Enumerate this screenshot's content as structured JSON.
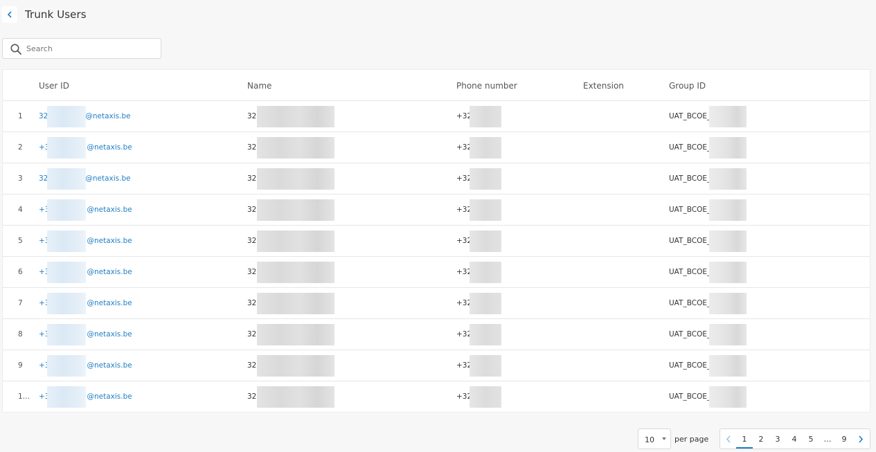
{
  "header": {
    "title": "Trunk Users"
  },
  "search": {
    "placeholder": "Search",
    "value": ""
  },
  "table": {
    "columns": {
      "user_id": "User ID",
      "name": "Name",
      "phone": "Phone number",
      "extension": "Extension",
      "group_id": "Group ID"
    },
    "rows": [
      {
        "index": "1",
        "user_prefix": "32",
        "user_suffix": "@netaxis.be",
        "name_prefix": "32",
        "phone_prefix": "+32",
        "extension": "",
        "group_prefix": "UAT_BCOE_"
      },
      {
        "index": "2",
        "user_prefix": "+3",
        "user_suffix": "@netaxis.be",
        "name_prefix": "32",
        "phone_prefix": "+32",
        "extension": "",
        "group_prefix": "UAT_BCOE_"
      },
      {
        "index": "3",
        "user_prefix": "32",
        "user_suffix": "@netaxis.be",
        "name_prefix": "32",
        "phone_prefix": "+32",
        "extension": "",
        "group_prefix": "UAT_BCOE_"
      },
      {
        "index": "4",
        "user_prefix": "+3",
        "user_suffix": "@netaxis.be",
        "name_prefix": "32",
        "phone_prefix": "+32",
        "extension": "",
        "group_prefix": "UAT_BCOE_"
      },
      {
        "index": "5",
        "user_prefix": "+3",
        "user_suffix": "@netaxis.be",
        "name_prefix": "32",
        "phone_prefix": "+32",
        "extension": "",
        "group_prefix": "UAT_BCOE_"
      },
      {
        "index": "6",
        "user_prefix": "+3",
        "user_suffix": "@netaxis.be",
        "name_prefix": "32",
        "phone_prefix": "+32",
        "extension": "",
        "group_prefix": "UAT_BCOE_"
      },
      {
        "index": "7",
        "user_prefix": "+3",
        "user_suffix": "@netaxis.be",
        "name_prefix": "32",
        "phone_prefix": "+32",
        "extension": "",
        "group_prefix": "UAT_BCOE_"
      },
      {
        "index": "8",
        "user_prefix": "+3",
        "user_suffix": "@netaxis.be",
        "name_prefix": "32",
        "phone_prefix": "+32",
        "extension": "",
        "group_prefix": "UAT_BCOE_"
      },
      {
        "index": "9",
        "user_prefix": "+3",
        "user_suffix": "@netaxis.be",
        "name_prefix": "32",
        "phone_prefix": "+32",
        "extension": "",
        "group_prefix": "UAT_BCOE_"
      },
      {
        "index": "1…",
        "user_prefix": "+3",
        "user_suffix": "@netaxis.be",
        "name_prefix": "32",
        "phone_prefix": "+32",
        "extension": "",
        "group_prefix": "UAT_BCOE_"
      }
    ]
  },
  "pagination": {
    "per_page_value": "10",
    "per_page_label": "per page",
    "pages": [
      "1",
      "2",
      "3",
      "4",
      "5",
      "…",
      "9"
    ],
    "current_page": "1",
    "prev_icon": "chevron-left-icon",
    "next_icon": "chevron-right-icon"
  },
  "colors": {
    "accent": "#1f7fc4",
    "background": "#f7f7f7",
    "surface": "#ffffff",
    "border": "#e6e6e6"
  }
}
